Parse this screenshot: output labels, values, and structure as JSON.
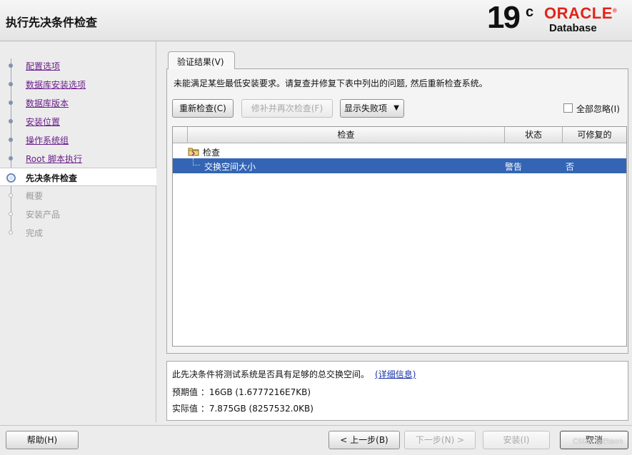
{
  "header": {
    "title": "执行先决条件检查",
    "logo": {
      "version": "19",
      "superscript": "c",
      "brand": "ORACLE",
      "registered": "®",
      "product": "Database",
      "brand_color": "#E2231A"
    }
  },
  "steps": [
    {
      "label": "配置选项",
      "state": "done"
    },
    {
      "label": "数据库安装选项",
      "state": "done"
    },
    {
      "label": "数据库版本",
      "state": "done"
    },
    {
      "label": "安装位置",
      "state": "done"
    },
    {
      "label": "操作系统组",
      "state": "done"
    },
    {
      "label": "Root 脚本执行",
      "state": "done"
    },
    {
      "label": "先决条件检查",
      "state": "current"
    },
    {
      "label": "概要",
      "state": "future"
    },
    {
      "label": "安装产品",
      "state": "future"
    },
    {
      "label": "完成",
      "state": "future"
    }
  ],
  "tab": {
    "label": "验证结果(V)"
  },
  "message": "未能满足某些最低安装要求。请复查并修复下表中列出的问题, 然后重新检查系统。",
  "toolbar": {
    "recheck": "重新检查(C)",
    "fix_recheck": "修补并再次检查(F)",
    "show_failed": "显示失败项",
    "ignore_all": "全部忽略(I)"
  },
  "table": {
    "columns": [
      "检查",
      "状态",
      "可修复的"
    ],
    "group": "检查",
    "rows": [
      {
        "check": "交换空间大小",
        "status": "警告",
        "fixable": "否"
      }
    ],
    "selection_color": "#3465B4"
  },
  "details": {
    "description": "此先决条件将测试系统是否具有足够的总交换空间。",
    "more_link": "(详细信息)",
    "expected": "预期值 ：16GB (1.6777216E7KB)",
    "actual": "实际值 ：7.875GB (8257532.0KB)"
  },
  "footer": {
    "help": "帮助(H)",
    "back": "< 上一步(B)",
    "next": "下一步(N) >",
    "install": "安装(I)",
    "cancel": "取消",
    "watermark": "CSDN @Etaon"
  }
}
